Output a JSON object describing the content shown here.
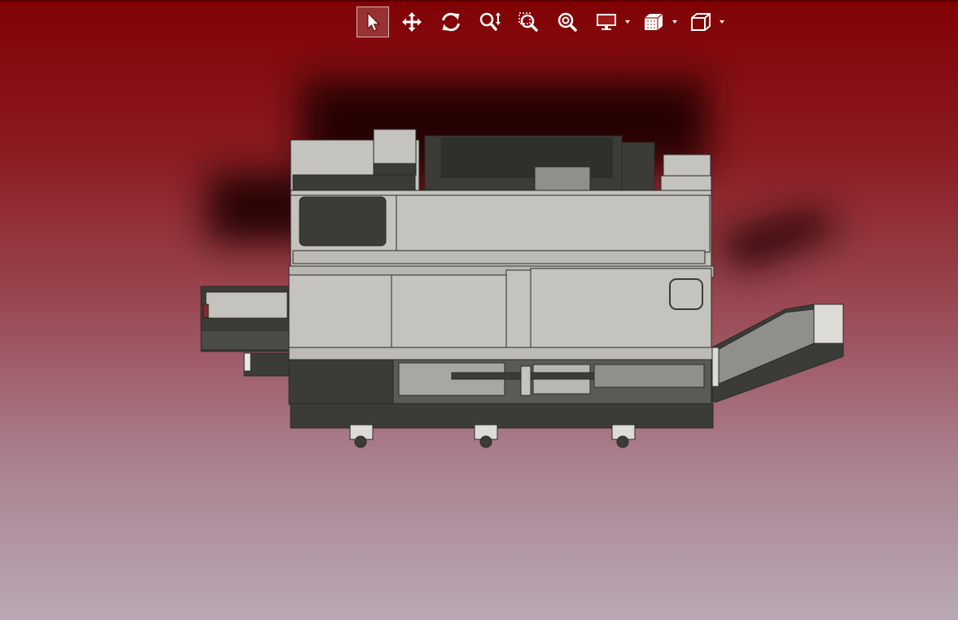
{
  "viewer": {
    "colors": {
      "background_top": "#800204",
      "background_bottom": "#b8a9b5",
      "toolbar_icon": "#ffffff",
      "model_light": "#c4c3bd",
      "model_dark": "#3b3c37"
    },
    "toolbar": [
      {
        "id": "select",
        "icon": "pointer-arrow-icon",
        "active": true
      },
      {
        "id": "pan",
        "icon": "move-arrows-icon",
        "active": false
      },
      {
        "id": "rotate",
        "icon": "rotate-icon",
        "active": false
      },
      {
        "id": "zoom-vertical",
        "icon": "zoom-vertical-icon",
        "active": false
      },
      {
        "id": "zoom-window",
        "icon": "zoom-window-icon",
        "active": false
      },
      {
        "id": "zoom-fit",
        "icon": "zoom-fit-icon",
        "active": false
      },
      {
        "id": "display-mode",
        "icon": "monitor-icon",
        "active": false,
        "dropdown": true
      },
      {
        "id": "sections",
        "icon": "section-cube-icon",
        "active": false,
        "dropdown": true
      },
      {
        "id": "views",
        "icon": "view-cube-icon",
        "active": false,
        "dropdown": true
      }
    ]
  }
}
